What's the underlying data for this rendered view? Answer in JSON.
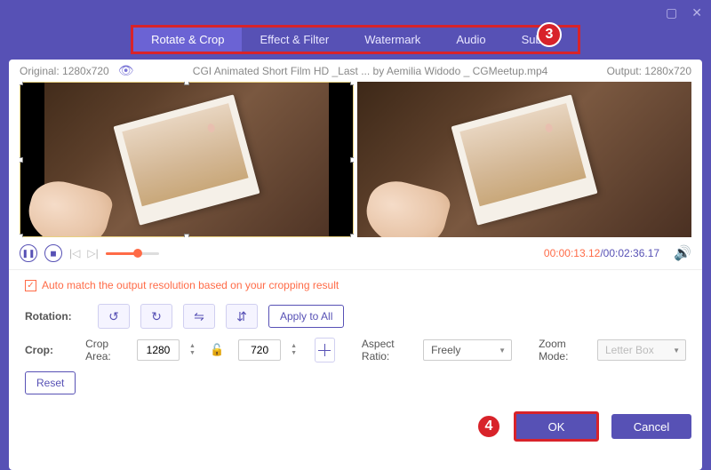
{
  "titlebar": {
    "minimize": "▢",
    "close": "✕"
  },
  "tabs": {
    "rotate_crop": "Rotate & Crop",
    "effect_filter": "Effect & Filter",
    "watermark": "Watermark",
    "audio": "Audio",
    "subtitle": "Subtitle"
  },
  "annotations": {
    "step3": "3",
    "step4": "4"
  },
  "info": {
    "original_label": "Original: 1280x720",
    "filename": "CGI Animated Short Film HD _Last ... by Aemilia Widodo _ CGMeetup.mp4",
    "output_label": "Output: 1280x720"
  },
  "playbar": {
    "current": "00:00:13.12",
    "sep": "/",
    "total": "00:02:36.17"
  },
  "auto_match": {
    "label": "Auto match the output resolution based on your cropping result"
  },
  "rotation": {
    "label": "Rotation:",
    "apply_all": "Apply to All"
  },
  "crop": {
    "label": "Crop:",
    "area_label": "Crop Area:",
    "width": "1280",
    "height": "720",
    "aspect_label": "Aspect Ratio:",
    "aspect_value": "Freely",
    "zoom_label": "Zoom Mode:",
    "zoom_value": "Letter Box",
    "reset": "Reset"
  },
  "footer": {
    "ok": "OK",
    "cancel": "Cancel"
  }
}
